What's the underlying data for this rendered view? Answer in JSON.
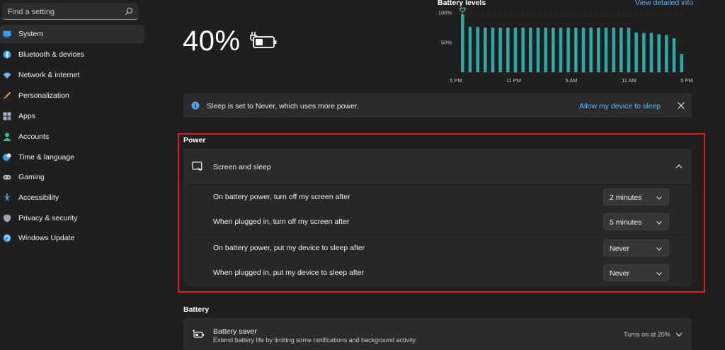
{
  "sidebar": {
    "search": {
      "placeholder": "Find a setting"
    },
    "items": [
      {
        "label": "System",
        "icon": "system-icon",
        "color": "#3b9ee8",
        "active": true
      },
      {
        "label": "Bluetooth & devices",
        "icon": "bluetooth-icon",
        "color": "#3b9ee8"
      },
      {
        "label": "Network & internet",
        "icon": "wifi-icon",
        "color": "#6ab8f0"
      },
      {
        "label": "Personalization",
        "icon": "brush-icon",
        "color": "#e8a040"
      },
      {
        "label": "Apps",
        "icon": "apps-icon",
        "color": "#aab4c4"
      },
      {
        "label": "Accounts",
        "icon": "accounts-icon",
        "color": "#3dbf8a"
      },
      {
        "label": "Time & language",
        "icon": "globe-clock-icon",
        "color": "#3b9ee8"
      },
      {
        "label": "Gaming",
        "icon": "gamepad-icon",
        "color": "#b8b8b8"
      },
      {
        "label": "Accessibility",
        "icon": "accessibility-icon",
        "color": "#3b9ee8"
      },
      {
        "label": "Privacy & security",
        "icon": "shield-icon",
        "color": "#9aa4b0"
      },
      {
        "label": "Windows Update",
        "icon": "update-icon",
        "color": "#3b9ee8"
      }
    ]
  },
  "battery": {
    "percent_label": "40%",
    "icon": "battery-charging-icon"
  },
  "chart_data": {
    "type": "bar",
    "title": "Battery levels",
    "link": "View detailed info",
    "y_tick_labels": [
      "100%",
      "50%"
    ],
    "x_tick_labels": [
      "5 PM",
      "11 PM",
      "5 AM",
      "11 AM",
      "5 PM"
    ],
    "ylim": [
      0,
      100
    ],
    "grid": true,
    "marker": "plug-icon",
    "color": "#2fa9a6",
    "values": [
      98,
      76,
      76,
      75,
      75,
      75,
      75,
      75,
      75,
      75,
      75,
      75,
      75,
      75,
      75,
      75,
      75,
      75,
      75,
      75,
      75,
      75,
      75,
      67,
      66,
      66,
      64,
      63,
      57,
      31
    ]
  },
  "banner": {
    "text": "Sleep is set to Never, which uses more power.",
    "link": "Allow my device to sleep"
  },
  "power": {
    "section_title": "Power",
    "panel_title": "Screen and sleep",
    "rows": [
      {
        "label": "On battery power, turn off my screen after",
        "value": "2 minutes"
      },
      {
        "label": "When plugged in, turn off my screen after",
        "value": "5 minutes"
      },
      {
        "label": "On battery power, put my device to sleep after",
        "value": "Never"
      },
      {
        "label": "When plugged in, put my device to sleep after",
        "value": "Never"
      }
    ]
  },
  "battery_section": {
    "section_title": "Battery",
    "saver_title": "Battery saver",
    "saver_desc": "Extend battery life by limiting some notifications and background activity",
    "saver_status": "Turns on at 20%"
  },
  "colors": {
    "accent_link": "#60b8f0",
    "highlight_box": "#e01b24"
  }
}
